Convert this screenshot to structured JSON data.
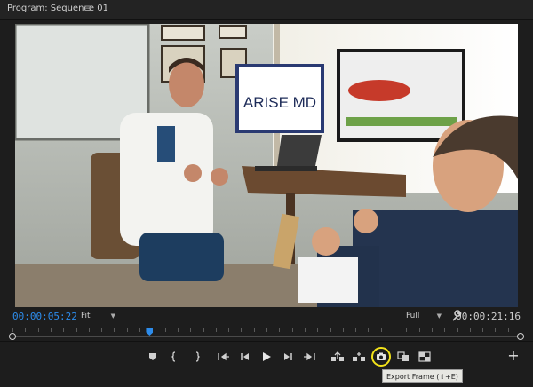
{
  "panel": {
    "title": "Program: Sequence 01",
    "menu_icon": "hamburger-menu-icon"
  },
  "video": {
    "monitor_brand": "ARISE MD"
  },
  "info": {
    "timecode_current": "00:00:05:22",
    "zoom_select": "Fit",
    "resolution_select": "Full",
    "timecode_duration": "00:00:21:16"
  },
  "timeline": {
    "playhead_fraction": 0.27
  },
  "transport": {
    "buttons": [
      "add-marker-icon",
      "mark-in-icon",
      "mark-out-icon",
      "go-to-in-icon",
      "step-back-icon",
      "play-icon",
      "step-forward-icon",
      "go-to-out-icon",
      "lift-icon",
      "extract-icon",
      "export-frame-icon",
      "comparison-view-icon",
      "multi-camera-icon"
    ],
    "add_button": "+"
  },
  "tooltip": {
    "text": "Export Frame (⇧+E)"
  },
  "colors": {
    "accent": "#2d8ceb",
    "highlight_ring": "#f2e21a"
  }
}
